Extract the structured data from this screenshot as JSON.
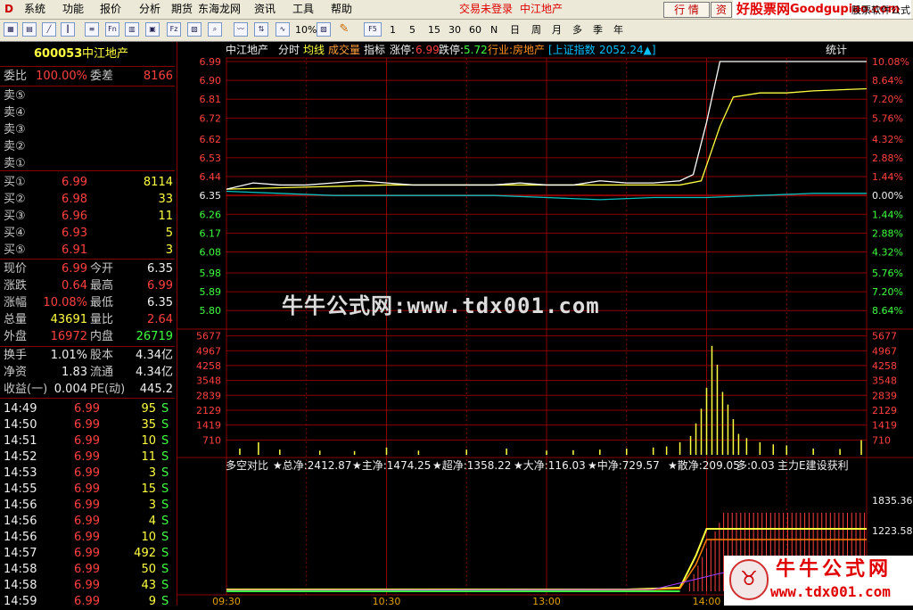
{
  "menu": {
    "items": [
      "系统",
      "功能",
      "报价",
      "分析",
      "期货",
      "东海龙网",
      "资讯",
      "工具",
      "帮助"
    ],
    "status_text": "交易未登录",
    "stock_title": "中江地产",
    "right_buttons": [
      "行 情",
      "资"
    ],
    "brand_top": "好股票网",
    "brand_top_url": "Goodgupiao.com",
    "brand_top_tail": "股票软件公式"
  },
  "toolbar": {
    "fs_label": "F5",
    "periods": [
      "1",
      "5",
      "15",
      "30",
      "60",
      "N",
      "日",
      "周",
      "月",
      "多",
      "季",
      "年"
    ],
    "pct_label": "10%"
  },
  "quote": {
    "code": "600053",
    "name": "中江地产",
    "weibi_label": "委比",
    "weibi_value": "100.00%",
    "weicha_label": "委差",
    "weicha_value": "8166",
    "sells": [
      {
        "label": "卖⑤",
        "price": "",
        "vol": ""
      },
      {
        "label": "卖④",
        "price": "",
        "vol": ""
      },
      {
        "label": "卖③",
        "price": "",
        "vol": ""
      },
      {
        "label": "卖②",
        "price": "",
        "vol": ""
      },
      {
        "label": "卖①",
        "price": "",
        "vol": ""
      }
    ],
    "buys": [
      {
        "label": "买①",
        "price": "6.99",
        "vol": "8114"
      },
      {
        "label": "买②",
        "price": "6.98",
        "vol": "33"
      },
      {
        "label": "买③",
        "price": "6.96",
        "vol": "11"
      },
      {
        "label": "买④",
        "price": "6.93",
        "vol": "5"
      },
      {
        "label": "买⑤",
        "price": "6.91",
        "vol": "3"
      }
    ],
    "stats": [
      {
        "l1": "现价",
        "v1": "6.99",
        "c1": "red",
        "l2": "今开",
        "v2": "6.35",
        "c2": "wht"
      },
      {
        "l1": "涨跌",
        "v1": "0.64",
        "c1": "red",
        "l2": "最高",
        "v2": "6.99",
        "c2": "red"
      },
      {
        "l1": "涨幅",
        "v1": "10.08%",
        "c1": "red",
        "l2": "最低",
        "v2": "6.35",
        "c2": "wht"
      },
      {
        "l1": "总量",
        "v1": "43691",
        "c1": "yel",
        "l2": "量比",
        "v2": "2.64",
        "c2": "red"
      },
      {
        "l1": "外盘",
        "v1": "16972",
        "c1": "red",
        "l2": "内盘",
        "v2": "26719",
        "c2": "grn"
      }
    ],
    "stats2": [
      {
        "l1": "换手",
        "v1": "1.01%",
        "l2": "股本",
        "v2": "4.34亿"
      },
      {
        "l1": "净资",
        "v1": "1.83",
        "l2": "流通",
        "v2": "4.34亿"
      },
      {
        "l1": "收益(一)",
        "v1": "0.004",
        "l2": "PE(动)",
        "v2": "445.2"
      }
    ],
    "ticks": [
      {
        "t": "14:49",
        "p": "6.99",
        "v": "95",
        "s": "S"
      },
      {
        "t": "14:50",
        "p": "6.99",
        "v": "35",
        "s": "S"
      },
      {
        "t": "14:51",
        "p": "6.99",
        "v": "10",
        "s": "S"
      },
      {
        "t": "14:52",
        "p": "6.99",
        "v": "11",
        "s": "S"
      },
      {
        "t": "14:53",
        "p": "6.99",
        "v": "3",
        "s": "S"
      },
      {
        "t": "14:55",
        "p": "6.99",
        "v": "15",
        "s": "S"
      },
      {
        "t": "14:56",
        "p": "6.99",
        "v": "3",
        "s": "S"
      },
      {
        "t": "14:56",
        "p": "6.99",
        "v": "4",
        "s": "S"
      },
      {
        "t": "14:56",
        "p": "6.99",
        "v": "10",
        "s": "S"
      },
      {
        "t": "14:57",
        "p": "6.99",
        "v": "492",
        "s": "S"
      },
      {
        "t": "14:58",
        "p": "6.99",
        "v": "50",
        "s": "S"
      },
      {
        "t": "14:58",
        "p": "6.99",
        "v": "43",
        "s": "S"
      },
      {
        "t": "14:59",
        "p": "6.99",
        "v": "9",
        "s": "S"
      }
    ]
  },
  "chart_header": {
    "name": "中江地产",
    "mode1": "分时",
    "mode2": "均线",
    "mode3": "成交量",
    "mode4": "指标",
    "limit_up": "涨停:",
    "limit_up_val": "6.99",
    "limit_down": "跌停:",
    "limit_down_val": "5.72",
    "industry": "行业:房地产",
    "index_label": "[上证指数",
    "index_val": "2052.24▲]",
    "stat_btn": "统计"
  },
  "indicator_header": {
    "name": "多空对比",
    "items": [
      "★总净:2412.87",
      "★主净:1474.25",
      "★超净:1358.22",
      "★大净:116.03",
      "★中净:729.57",
      "★散净:209.05",
      "多:0.03",
      "主力E建设获利"
    ]
  },
  "watermark": "牛牛公式网:www.tdx001.com",
  "brand_bottom": {
    "title": "牛牛公式网",
    "url": "www.tdx001.com"
  },
  "colors": {
    "up": "#ff4040",
    "down": "#40ff40",
    "grid": "#8b0000",
    "price_line": "#ffffff",
    "avg_line": "#ffff40",
    "index_line": "#00c0c0"
  },
  "chart_data": {
    "type": "line",
    "price_axis": {
      "left_ticks": [
        "6.99",
        "6.90",
        "6.81",
        "6.72",
        "6.62",
        "6.53",
        "6.44",
        "6.35",
        "6.26",
        "6.17",
        "6.08",
        "5.98",
        "5.89",
        "5.80"
      ],
      "right_ticks": [
        "10.08%",
        "8.64%",
        "7.20%",
        "5.76%",
        "4.32%",
        "2.88%",
        "1.44%",
        "0.00%",
        "1.44%",
        "2.88%",
        "4.32%",
        "5.76%",
        "7.20%",
        "8.64%"
      ],
      "ylim": [
        5.72,
        6.99
      ],
      "prev_close": 6.35
    },
    "volume_axis": {
      "ticks": [
        "5677",
        "4967",
        "4258",
        "3548",
        "2839",
        "2129",
        "1419",
        "710"
      ],
      "ylim": [
        0,
        6000
      ]
    },
    "indicator_axis": {
      "ticks": [
        "1835.36",
        "1223.58"
      ]
    },
    "x_ticks": [
      "09:30",
      "10:30",
      "13:00",
      "14:00"
    ],
    "series": [
      {
        "name": "price",
        "minute": [
          0,
          10,
          20,
          30,
          40,
          50,
          60,
          70,
          80,
          90,
          100,
          110,
          120,
          130,
          140,
          150,
          160,
          170,
          175,
          180,
          185,
          190,
          195,
          200,
          205,
          210,
          240
        ],
        "values": [
          6.38,
          6.41,
          6.4,
          6.4,
          6.41,
          6.42,
          6.41,
          6.4,
          6.4,
          6.4,
          6.4,
          6.41,
          6.4,
          6.4,
          6.42,
          6.41,
          6.41,
          6.42,
          6.45,
          6.7,
          6.99,
          6.99,
          6.99,
          6.99,
          6.99,
          6.99,
          6.99
        ]
      },
      {
        "name": "avg",
        "minute": [
          0,
          30,
          60,
          90,
          120,
          150,
          170,
          178,
          185,
          190,
          200,
          210,
          220,
          240
        ],
        "values": [
          6.38,
          6.39,
          6.4,
          6.4,
          6.4,
          6.4,
          6.4,
          6.42,
          6.68,
          6.82,
          6.84,
          6.84,
          6.85,
          6.86
        ]
      },
      {
        "name": "index",
        "minute": [
          0,
          20,
          40,
          60,
          80,
          100,
          120,
          140,
          160,
          180,
          200,
          220,
          240
        ],
        "values": [
          6.37,
          6.36,
          6.35,
          6.35,
          6.35,
          6.35,
          6.34,
          6.33,
          6.34,
          6.34,
          6.35,
          6.36,
          6.36
        ]
      }
    ],
    "volumes": {
      "minute": [
        5,
        12,
        20,
        35,
        48,
        60,
        72,
        90,
        105,
        120,
        130,
        140,
        150,
        160,
        165,
        170,
        174,
        176,
        178,
        180,
        182,
        184,
        186,
        188,
        190,
        192,
        195,
        200,
        205,
        210,
        220,
        230,
        238
      ],
      "values": [
        300,
        600,
        250,
        200,
        180,
        350,
        200,
        250,
        300,
        200,
        220,
        250,
        300,
        350,
        400,
        600,
        900,
        1500,
        2200,
        3200,
        5200,
        4300,
        3000,
        2400,
        1700,
        1000,
        800,
        600,
        500,
        450,
        300,
        280,
        700
      ]
    }
  }
}
